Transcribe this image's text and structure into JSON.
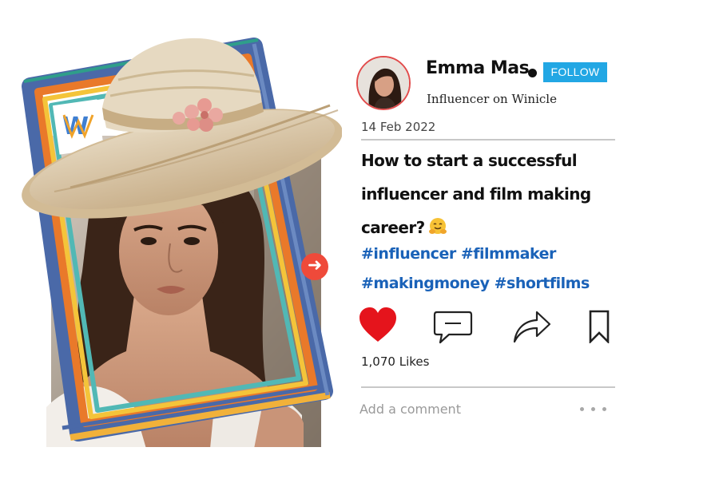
{
  "post": {
    "user_name": "Emma Mas",
    "follow_label": "FOLLOW",
    "user_subtitle": "Influencer on Winicle",
    "date": "14 Feb 2022",
    "title": "How to start a successful influencer and film making career?",
    "hashtags": [
      "#influencer",
      "#filmmaker",
      "#makingmoney",
      "#shortfilms"
    ],
    "likes": "1,070 Likes",
    "comment_placeholder": "Add a comment"
  },
  "icons": {
    "next": "arrow-right-icon",
    "like": "heart-icon",
    "comment": "comment-bubble-icon",
    "share": "share-arrow-icon",
    "save": "bookmark-icon",
    "more": "more-dots-icon",
    "emoji": "hugging-face-emoji"
  },
  "colors": {
    "follow_button": "#22a7e4",
    "heart": "#e5141c",
    "hashtag": "#1a62b8",
    "avatar_ring": "#e14b4b",
    "next_button": "#ef4a3a"
  }
}
